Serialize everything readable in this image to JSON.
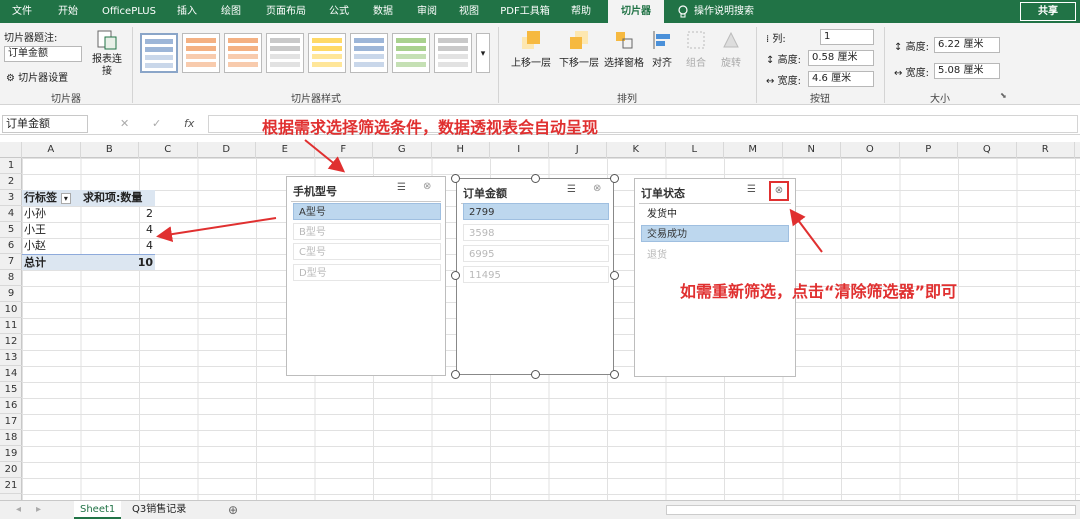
{
  "tabs": [
    "文件",
    "开始",
    "OfficePLUS",
    "插入",
    "绘图",
    "页面布局",
    "公式",
    "数据",
    "审阅",
    "视图",
    "PDF工具箱",
    "帮助",
    "切片器",
    "操作说明搜索"
  ],
  "share": "共享",
  "ribbon": {
    "caption_label": "切片器题注:",
    "caption_value": "订单金额",
    "settings": "切片器设置",
    "report": "报表连接",
    "group1": "切片器",
    "group2": "切片器样式",
    "forward": "上移一层",
    "backward": "下移一层",
    "pane": "选择窗格",
    "align": "对齐",
    "group_obj": "组合",
    "rotate": "旋转",
    "group3": "排列",
    "cols_label": "列:",
    "cols_value": "1",
    "height_label": "高度:",
    "height_value": "0.58 厘米",
    "width_label": "宽度:",
    "width_value": "4.6 厘米",
    "group4": "按钮",
    "size_h_label": "高度:",
    "size_h_value": "6.22 厘米",
    "size_w_label": "宽度:",
    "size_w_value": "5.08 厘米",
    "group5": "大小"
  },
  "namebox": "订单金额",
  "fx": "fx",
  "columns": [
    "A",
    "B",
    "C",
    "D",
    "E",
    "F",
    "G",
    "H",
    "I",
    "J",
    "K",
    "L",
    "M",
    "N",
    "O",
    "P",
    "Q",
    "R"
  ],
  "rows": [
    "1",
    "2",
    "3",
    "4",
    "5",
    "6",
    "7",
    "8",
    "9",
    "10",
    "11",
    "12",
    "13",
    "14",
    "15",
    "16",
    "17",
    "18",
    "19",
    "20",
    "21"
  ],
  "pivot": {
    "h1": "行标签",
    "h2": "求和项:数量",
    "r1": "小孙",
    "v1": "2",
    "r2": "小王",
    "v2": "4",
    "r3": "小赵",
    "v3": "4",
    "total": "总计",
    "totalv": "10"
  },
  "slicer1": {
    "title": "手机型号",
    "items": [
      "A型号",
      "B型号",
      "C型号",
      "D型号"
    ]
  },
  "slicer2": {
    "title": "订单金额",
    "items": [
      "2799",
      "3598",
      "6995",
      "11495"
    ]
  },
  "slicer3": {
    "title": "订单状态",
    "items": [
      "发货中",
      "交易成功",
      "退货"
    ]
  },
  "annot1": "根据需求选择筛选条件，数据透视表会自动呈现",
  "annot2": "如需重新筛选，点击“清除筛选器”即可",
  "sheets": [
    "Sheet1",
    "Q3销售记录"
  ],
  "colors": {
    "excel_green": "#217346",
    "annot": "#e03030",
    "selected": "#bdd7ee"
  }
}
